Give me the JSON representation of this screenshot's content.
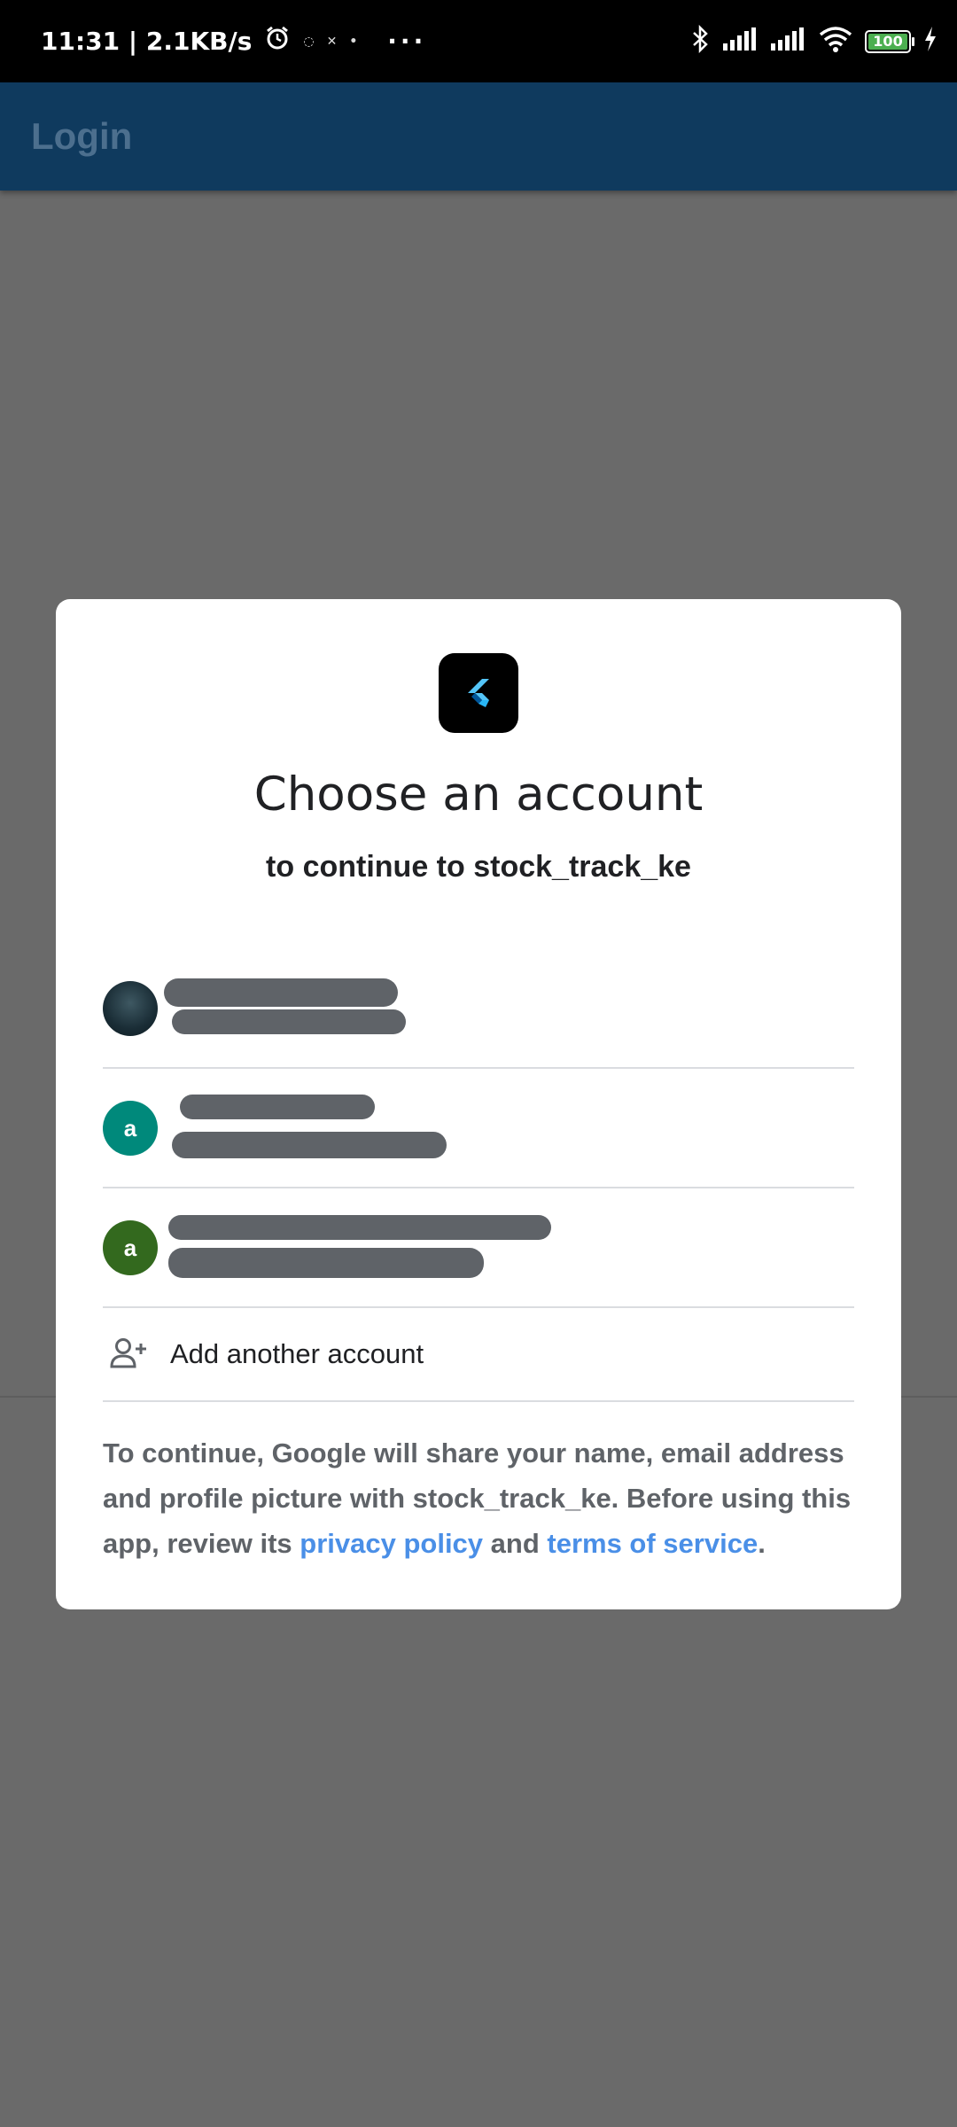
{
  "status_bar": {
    "time_speed": "11:31 | 2.1KB/s",
    "battery_level": "100",
    "battery_color": "#4caf50"
  },
  "app_bar": {
    "title": "Login",
    "background_color": "#0f3a5e"
  },
  "dialog": {
    "logo_icon": "flutter-logo-icon",
    "title": "Choose an account",
    "subtitle": "to continue to stock_track_ke",
    "accounts": [
      {
        "avatar": "photo",
        "avatar_letter": "",
        "avatar_color": "#1a2d36",
        "name_redacted": true,
        "email_redacted": true
      },
      {
        "avatar": "letter",
        "avatar_letter": "a",
        "avatar_color": "#00897b",
        "name_redacted": true,
        "email_redacted": true
      },
      {
        "avatar": "letter",
        "avatar_letter": "a",
        "avatar_color": "#33691e",
        "name_redacted": true,
        "email_redacted": true
      }
    ],
    "add_account": {
      "icon": "add-person-icon",
      "label": "Add another account"
    },
    "disclaimer": {
      "text_before": "To continue, Google will share your name, email address and profile picture with stock_track_ke. Before using this app, review its ",
      "privacy_link": "privacy policy",
      "text_middle": " and ",
      "terms_link": "terms of service",
      "text_after": ".",
      "link_color": "#4a8fe7"
    }
  }
}
